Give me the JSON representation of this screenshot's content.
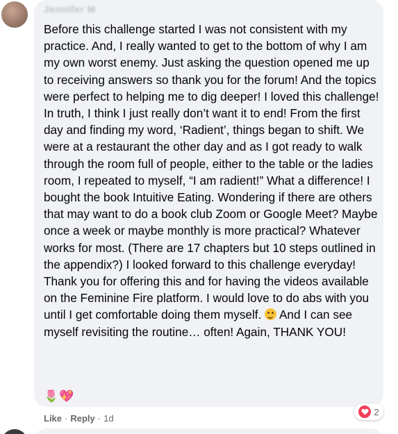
{
  "comment": {
    "author": "Jennifer M",
    "text": "Before this challenge started I was not consistent with my practice. And, I really wanted to get to the bottom of why I am my own worst enemy. Just asking the question opened me up to receiving answers so thank you for the forum! And the topics were perfect to helping me to dig deeper! I loved this challenge! In truth, I think I just really don’t want it to end! From the first day and finding my word, ‘Radient’, things began to shift. We were at a restaurant the other day and as I got ready to walk through the room full of people, either to the table or the ladies room, I repeated to myself, “I am radient!” What a difference! I bought the book Intuitive Eating. Wondering if there are others that may want to do a book club Zoom or Google Meet? Maybe once a week or maybe monthly is more practical? Whatever works for most. (There are 17 chapters but 10 steps outlined in the appendix?) I looked forward to this challenge everyday! Thank you for offering this and for having the videos available on the Feminine Fire platform. I would love to do abs with you until I get comfortable doing them myself.",
    "text_after_emoji": "And I can see myself revisiting the routine… often! Again, THANK YOU!",
    "inline_emoji": "winking-face",
    "trailing_emojis": [
      "🌷",
      "💖"
    ]
  },
  "reactions": {
    "type": "love",
    "count": "2",
    "color": "#f33e58"
  },
  "actions": {
    "like_label": "Like",
    "separator": "·",
    "reply_label": "Reply",
    "timestamp": "1d"
  },
  "colors": {
    "bubble": "#f0f2f5",
    "text": "#050505",
    "meta": "#65676b"
  }
}
